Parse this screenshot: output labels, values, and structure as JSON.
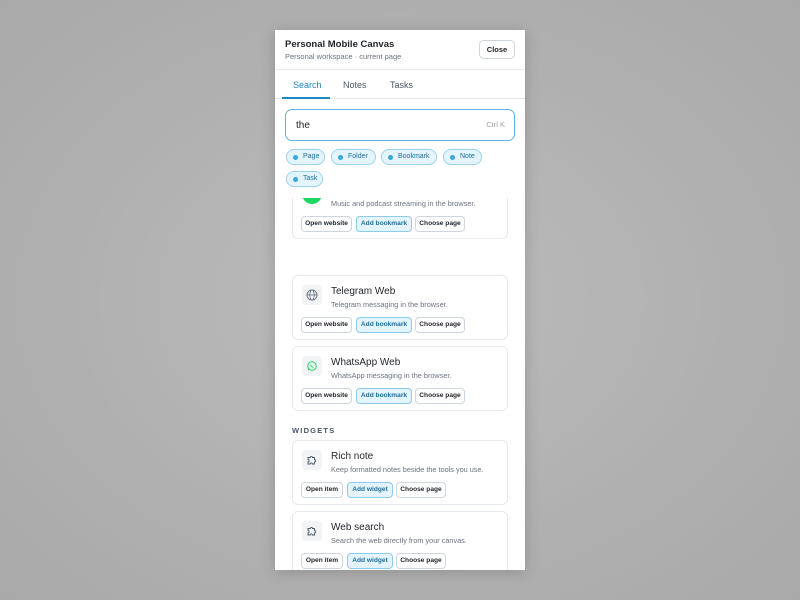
{
  "header": {
    "title": "Personal Mobile Canvas",
    "subtitle": "Personal workspace · current page",
    "close_label": "Close"
  },
  "tabs": [
    {
      "label": "Search",
      "active": true
    },
    {
      "label": "Notes",
      "active": false
    },
    {
      "label": "Tasks",
      "active": false
    }
  ],
  "search": {
    "value": "the",
    "shortcut": "Ctrl K"
  },
  "filters": [
    "Page",
    "Folder",
    "Bookmark",
    "Note",
    "Task"
  ],
  "websites": [
    {
      "title": "",
      "description": "Music and podcast streaming in the browser.",
      "icon": "spotify-icon",
      "actions": [
        "Open website",
        "Add bookmark",
        "Choose page"
      ]
    },
    {
      "title": "Telegram Web",
      "description": "Telegram messaging in the browser.",
      "icon": "globe-icon",
      "actions": [
        "Open website",
        "Add bookmark",
        "Choose page"
      ]
    },
    {
      "title": "WhatsApp Web",
      "description": "WhatsApp messaging in the browser.",
      "icon": "whatsapp-icon",
      "actions": [
        "Open website",
        "Add bookmark",
        "Choose page"
      ]
    }
  ],
  "widgets_section": {
    "label": "WIDGETS"
  },
  "widgets": [
    {
      "title": "Rich note",
      "description": "Keep formatted notes beside the tools you use.",
      "icon": "puzzle-icon",
      "actions": [
        "Open item",
        "Add widget",
        "Choose page"
      ]
    },
    {
      "title": "Web search",
      "description": "Search the web directly from your canvas.",
      "icon": "puzzle-icon",
      "actions": [
        "Open item",
        "Add widget",
        "Choose page"
      ]
    }
  ],
  "colors": {
    "accent": "#1c8ac2",
    "chip_bg": "#e3f4fc",
    "backdrop": "#b3b3b3",
    "whatsapp_green": "#25d366",
    "spotify_green": "#1ed760"
  }
}
